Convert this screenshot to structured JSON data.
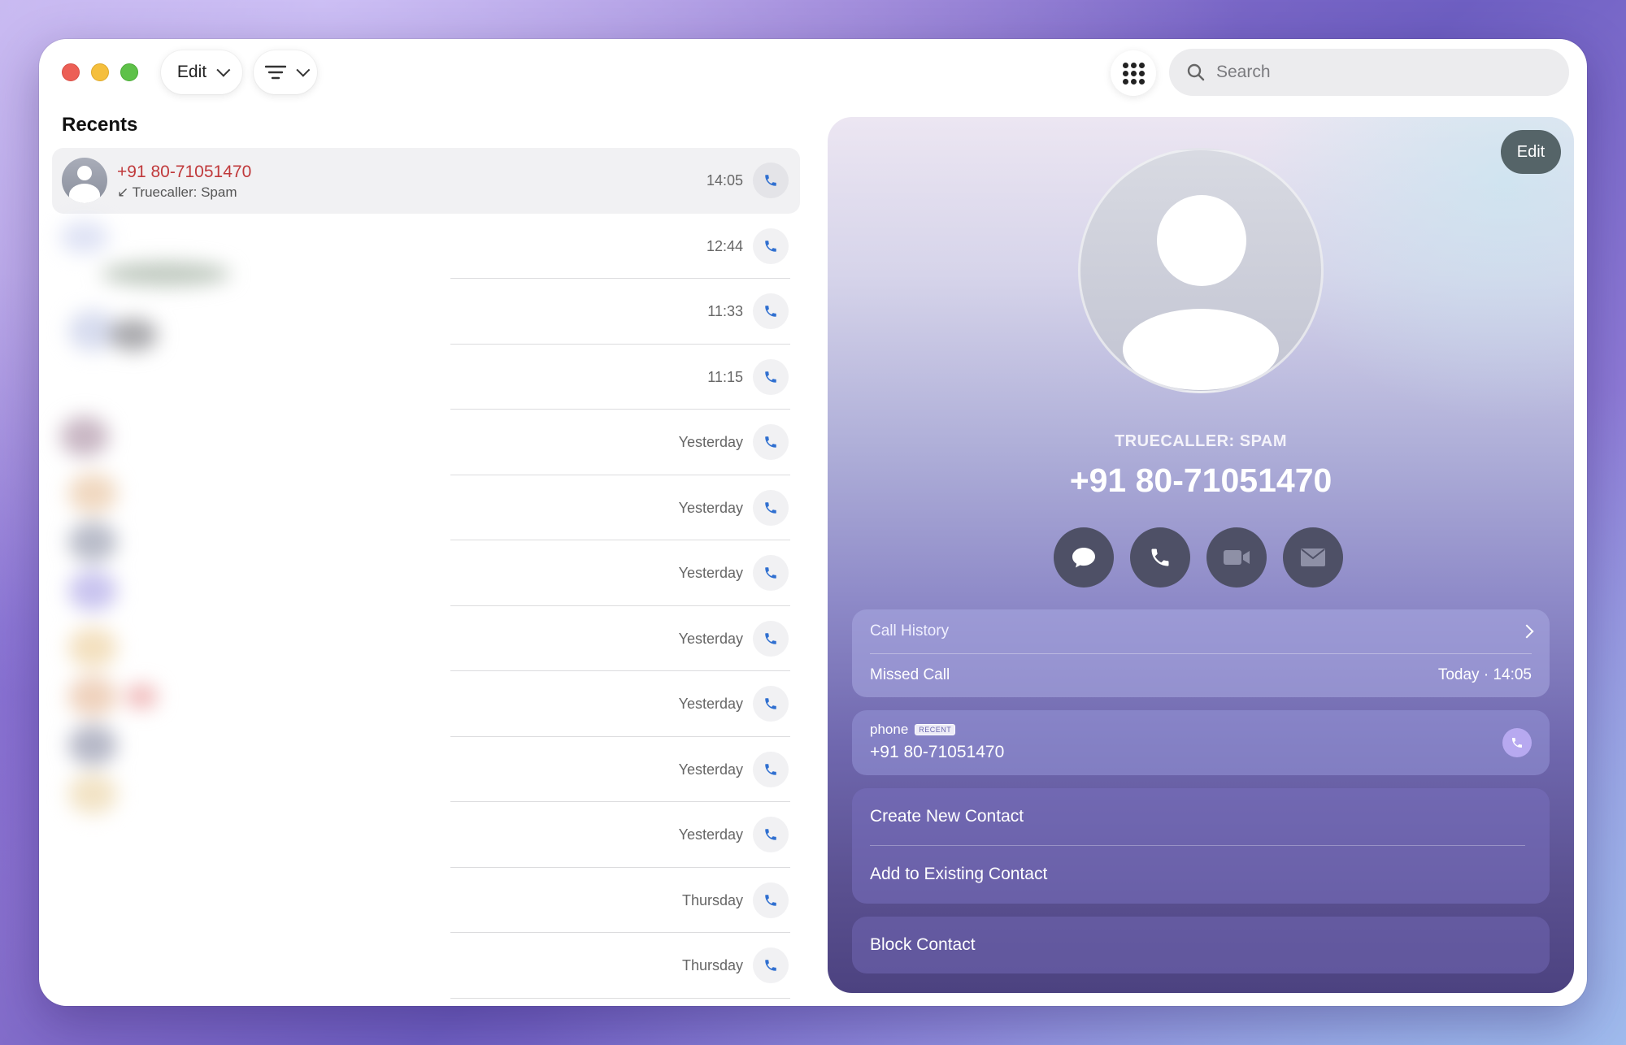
{
  "toolbar": {
    "edit_label": "Edit",
    "search_placeholder": "Search"
  },
  "recents": {
    "title": "Recents",
    "selected": {
      "number": "+91 80-71051470",
      "subtitle": "Truecaller: Spam",
      "direction_icon": "incoming-arrow-icon",
      "time": "14:05"
    },
    "times": [
      "12:44",
      "11:33",
      "11:15",
      "Yesterday",
      "Yesterday",
      "Yesterday",
      "Yesterday",
      "Yesterday",
      "Yesterday",
      "Yesterday",
      "Thursday",
      "Thursday"
    ]
  },
  "detail": {
    "edit_label": "Edit",
    "label": "TRUECALLER: SPAM",
    "number": "+91 80-71051470",
    "actions": [
      "message-icon",
      "phone-icon",
      "video-icon",
      "mail-icon"
    ],
    "call_history": {
      "title": "Call History",
      "entry_type": "Missed Call",
      "entry_time": "Today · 14:05"
    },
    "phone": {
      "label": "phone",
      "tag": "RECENT",
      "number": "+91 80-71051470"
    },
    "create_contact": "Create New Contact",
    "add_existing": "Add to Existing Contact",
    "block": "Block Contact"
  },
  "colors": {
    "spam_red": "#c0393b",
    "call_blue": "#2f6fd0"
  }
}
